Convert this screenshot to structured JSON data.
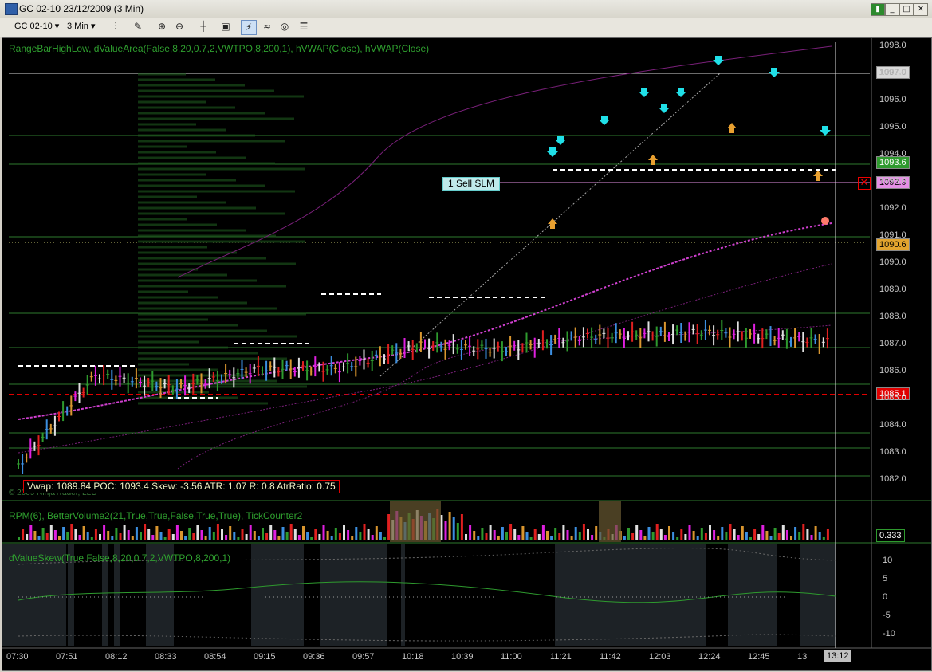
{
  "window": {
    "title": "GC 02-10  23/12/2009 (3 Min)",
    "buttons": [
      "▮",
      "_",
      "□",
      "✕"
    ]
  },
  "toolbar": {
    "instrument": "GC 02-10",
    "interval": "3 Min"
  },
  "panels": {
    "price_label": "RangeBarHighLow,  dValueArea(False,8,20,0.7,2,VWTPO,8,200,1),  hVWAP(Close),  hVWAP(Close)",
    "volume_label": "RPM(6),  BetterVolume2(21,True,True,False,True,True),  TickCounter2",
    "skew_label": "dValueSkew(True,False,8,20,0.7,2,VWTPO,8,200,1)",
    "copyright": "© 2009 NinjaTrader, LLC",
    "info_box": "Vwap: 1089.84 POC: 1093.4 Skew: -3.56 ATR: 1.07 R: 0.8 AtrRatio: 0.75",
    "order": "1  Sell SLM",
    "current_time": "13:12",
    "volume_value": "0.333"
  },
  "price_tags": [
    {
      "text": "1097.0",
      "bg": "#d8d8d8",
      "fg": "#000000"
    },
    {
      "text": "1093.6",
      "bg": "#2e9a2e",
      "fg": "#ffffff"
    },
    {
      "text": "1092.9",
      "bg": "#e58fe5",
      "fg": "#000000"
    },
    {
      "text": "1090.6",
      "bg": "#e3a42e",
      "fg": "#000000"
    },
    {
      "text": "1085.1",
      "bg": "#e00000",
      "fg": "#ffffff"
    }
  ],
  "axes": {
    "price_ticks": [
      "1098.0",
      "1097.0",
      "1096.0",
      "1095.0",
      "1094.0",
      "1093.0",
      "1092.0",
      "1091.0",
      "1090.0",
      "1089.0",
      "1088.0",
      "1087.0",
      "1086.0",
      "1085.0",
      "1084.0",
      "1083.0",
      "1082.0"
    ],
    "skew_ticks": [
      "10",
      "5",
      "0",
      "-5",
      "-10"
    ],
    "time_ticks": [
      "07:30",
      "07:51",
      "08:12",
      "08:33",
      "08:54",
      "09:15",
      "09:36",
      "09:57",
      "10:18",
      "10:39",
      "11:00",
      "11:21",
      "11:42",
      "12:03",
      "12:24",
      "12:45",
      "13"
    ]
  },
  "colors": {
    "bar_green": "#2e9a2e",
    "bar_blue": "#3c8fe0",
    "bar_orange": "#d9962f",
    "bar_magenta": "#e020e0",
    "vwap": "#d040d0",
    "band": "#7a207a",
    "poc": "#e00000"
  }
}
